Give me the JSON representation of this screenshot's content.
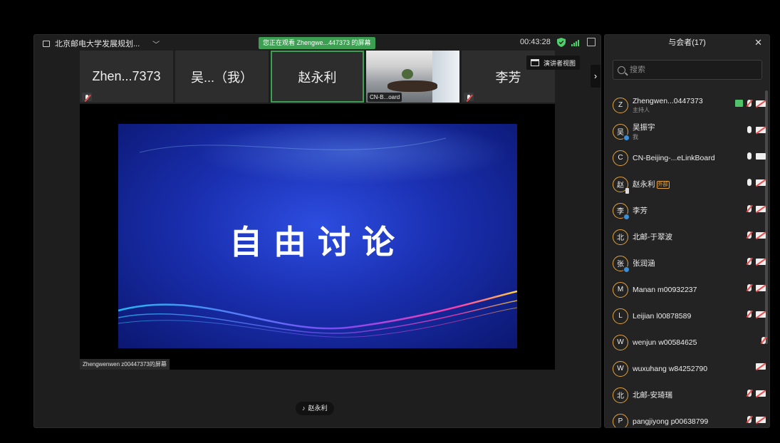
{
  "meeting": {
    "title": "北京邮电大学发展规划...",
    "viewing_badge": "您正在观看 Zhengwe...447373 的屏幕",
    "timer": "00:43:28",
    "presenter_view_label": "演讲者视图",
    "colors": {
      "accent_green": "#3c9f52",
      "signal_green": "#4fd06a"
    }
  },
  "tiles": [
    {
      "name": "Zhen...7373",
      "muted": true
    },
    {
      "name": "吴...（我）",
      "muted": false
    },
    {
      "name": "赵永利",
      "muted": false,
      "active": true
    },
    {
      "caption": "CN-B...oard",
      "camera": true
    },
    {
      "name": "李芳",
      "muted": true
    }
  ],
  "share": {
    "slide_text": "自由讨论",
    "label": "Zhengwenwen z00447373的屏幕"
  },
  "speaking": {
    "name": "赵永利"
  },
  "panel": {
    "title": "与会者(17)",
    "search_placeholder": "搜索",
    "participants": [
      {
        "initial": "Z",
        "name": "Zhengwen...0447373",
        "sub": "主持人",
        "sharing": true,
        "mic": "muted",
        "cam": "off"
      },
      {
        "initial": "吴",
        "name": "吴振宇",
        "sub": "我",
        "badge": "blue",
        "mic": "on",
        "cam": "off"
      },
      {
        "initial": "C",
        "name": "CN-Beijing-...eLinkBoard",
        "mic": "on",
        "cam": "on"
      },
      {
        "initial": "赵",
        "name": "赵永利",
        "tag": "外部",
        "badge": "phone",
        "mic": "on",
        "cam": "off"
      },
      {
        "initial": "李",
        "name": "李芳",
        "badge": "blue",
        "mic": "muted",
        "cam": "off"
      },
      {
        "initial": "北",
        "name": "北邮-于翠波",
        "mic": "muted",
        "cam": "off"
      },
      {
        "initial": "张",
        "name": "张润涵",
        "badge": "blue",
        "mic": "muted",
        "cam": "off"
      },
      {
        "initial": "M",
        "name": "Manan m00932237",
        "mic": "muted",
        "cam": "off"
      },
      {
        "initial": "L",
        "name": "Leijian l00878589",
        "mic": "muted",
        "cam": "off"
      },
      {
        "initial": "W",
        "name": "wenjun w00584625",
        "mic": "muted",
        "cam": "none"
      },
      {
        "initial": "W",
        "name": "wuxuhang w84252790",
        "mic": "none",
        "cam": "off"
      },
      {
        "initial": "北",
        "name": "北邮-安琦瑞",
        "mic": "muted",
        "cam": "off"
      },
      {
        "initial": "P",
        "name": "pangjiyong p00638799",
        "mic": "muted",
        "cam": "off"
      }
    ]
  }
}
